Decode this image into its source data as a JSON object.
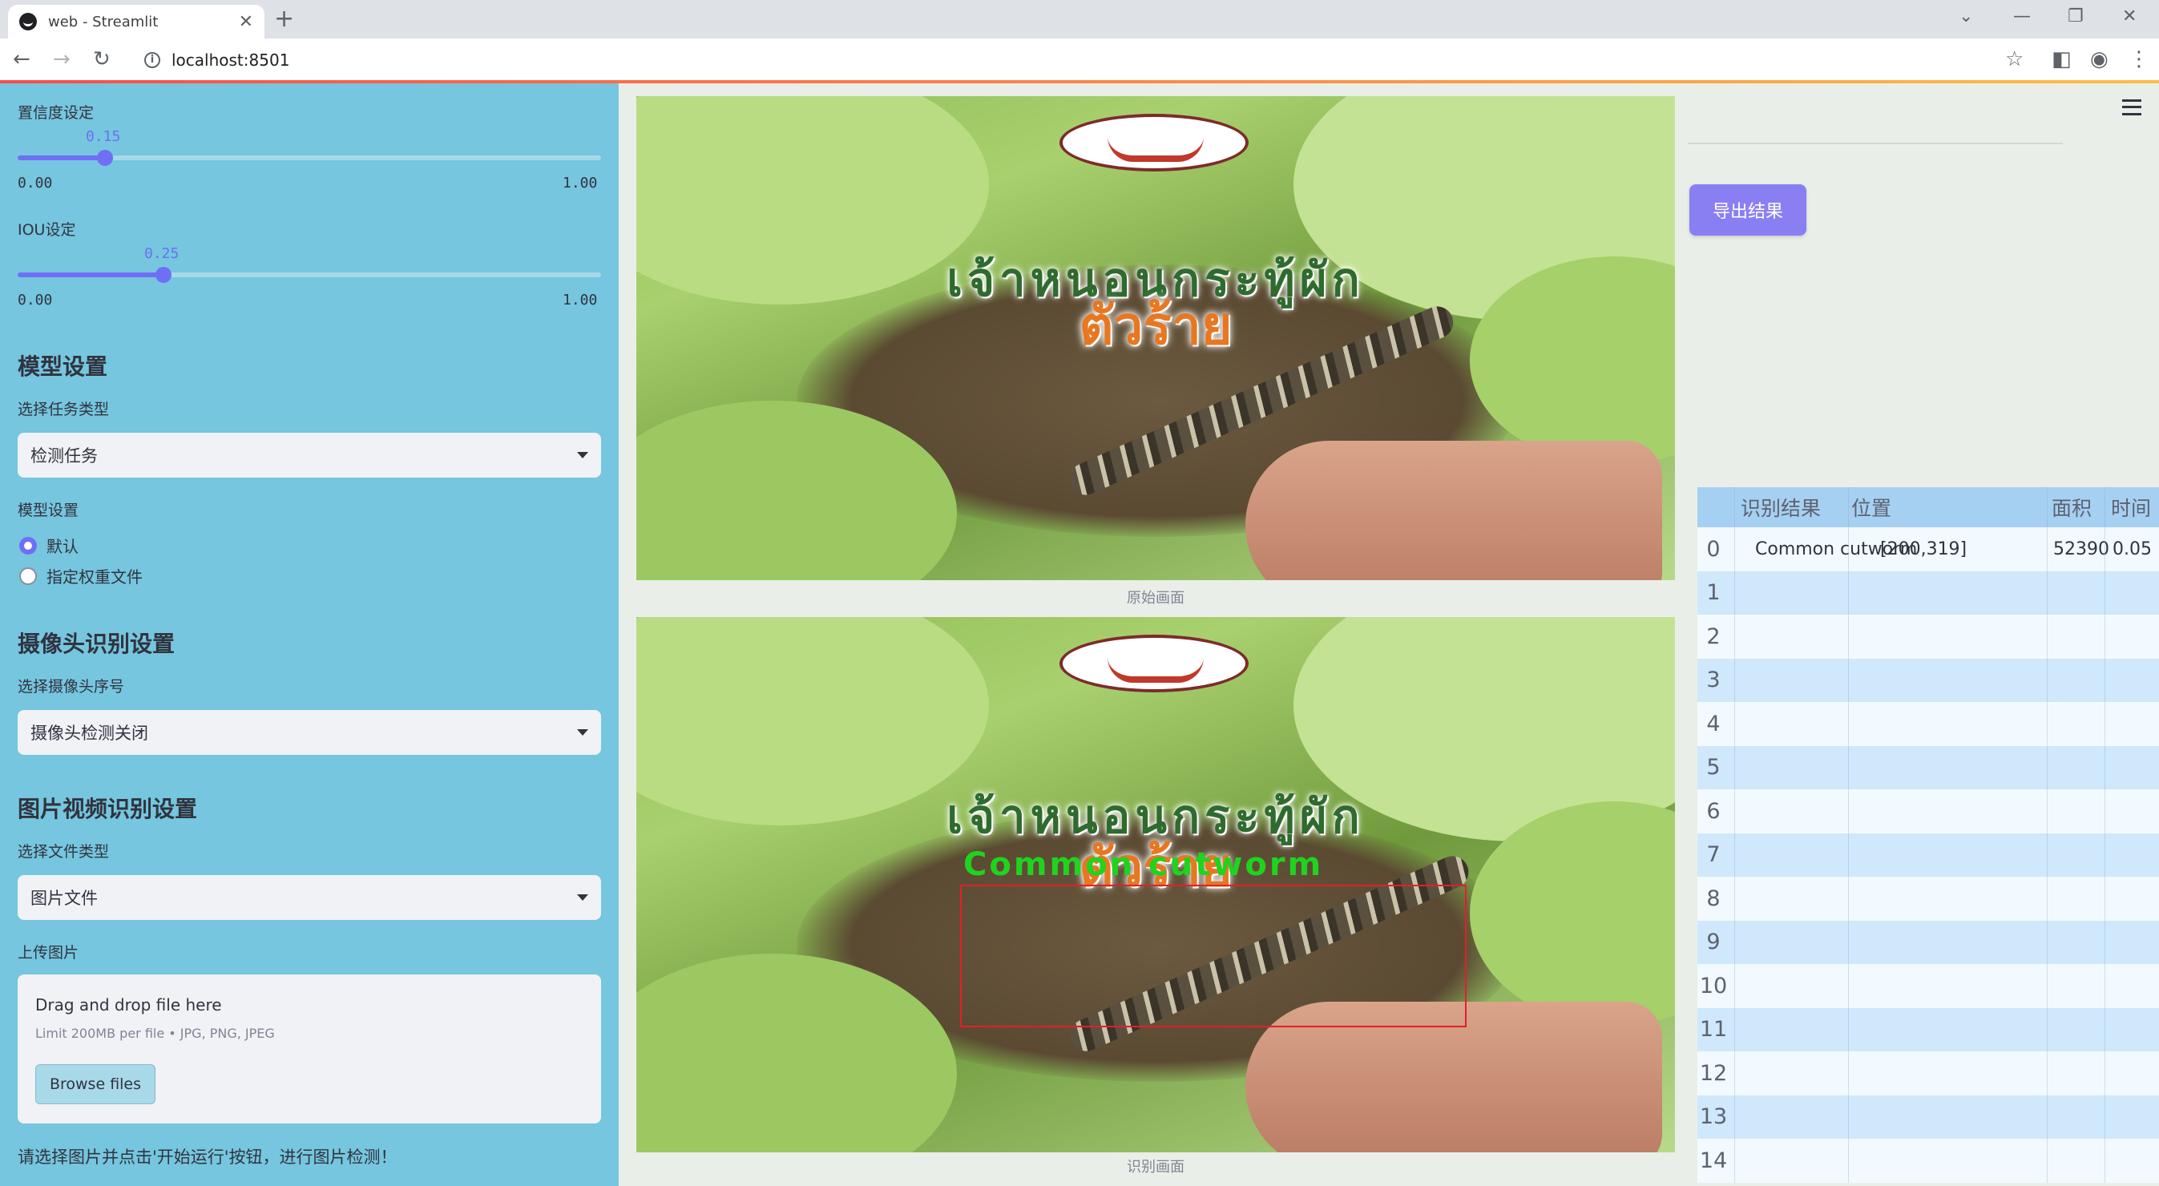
{
  "browser": {
    "tab_title": "web - Streamlit",
    "url": "localhost:8501",
    "new_tab": "+",
    "tab_close": "✕"
  },
  "sidebar": {
    "confidence": {
      "label": "置信度设定",
      "value": "0.15",
      "min": "0.00",
      "max": "1.00",
      "fraction": 0.15
    },
    "iou": {
      "label": "IOU设定",
      "value": "0.25",
      "min": "0.00",
      "max": "1.00",
      "fraction": 0.25
    },
    "model_section": "模型设置",
    "task_type_label": "选择任务类型",
    "task_type_value": "检测任务",
    "model_setting_label": "模型设置",
    "model_options": [
      "默认",
      "指定权重文件"
    ],
    "camera_section": "摄像头识别设置",
    "camera_label": "选择摄像头序号",
    "camera_value": "摄像头检测关闭",
    "media_section": "图片视频识别设置",
    "file_type_label": "选择文件类型",
    "file_type_value": "图片文件",
    "upload_label": "上传图片",
    "uploader": {
      "drag_text": "Drag and drop file here",
      "limit_text": "Limit 200MB per file • JPG, PNG, JPEG",
      "browse_button": "Browse files"
    },
    "hint": "请选择图片并点击'开始运行'按钮，进行图片检测！"
  },
  "main": {
    "original_caption": "原始画面",
    "result_caption": "识别画面",
    "detection_label": "Common cutworm",
    "thai_line1": "เจ้าหนอนกระทู้ผัก",
    "thai_line2": "ตัวร้าย"
  },
  "right_panel": {
    "export_button": "导出结果",
    "table": {
      "columns": [
        "识别结果",
        "位置",
        "面积",
        "时间"
      ],
      "rows": [
        {
          "index": "0",
          "result": "Common cutworm",
          "position": "[200,319]",
          "area": "52390",
          "time": "0.05"
        },
        {
          "index": "1"
        },
        {
          "index": "2"
        },
        {
          "index": "3"
        },
        {
          "index": "4"
        },
        {
          "index": "5"
        },
        {
          "index": "6"
        },
        {
          "index": "7"
        },
        {
          "index": "8"
        },
        {
          "index": "9"
        },
        {
          "index": "10"
        },
        {
          "index": "11"
        },
        {
          "index": "12"
        },
        {
          "index": "13"
        },
        {
          "index": "14"
        }
      ]
    }
  },
  "colors": {
    "sidebar_bg": "#75c6de",
    "accent": "#6f6ff5",
    "export_button": "#8a7ff2",
    "detection_box": "#e0202a",
    "detection_text": "#1fd31f"
  }
}
